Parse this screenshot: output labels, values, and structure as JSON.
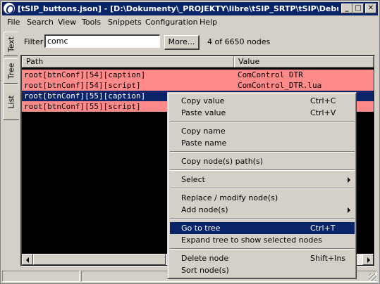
{
  "window": {
    "title": "[tSIP_buttons.json] - [D:\\Dokumenty\\_PROJEKTY\\libre\\tSIP_SRTP\\tSIP\\Debug...",
    "minimize_symbol": "_",
    "maximize_symbol": "□",
    "close_symbol": "✕"
  },
  "menubar": [
    "File",
    "Search",
    "View",
    "Tools",
    "Snippets",
    "Configuration",
    "Help"
  ],
  "side_tabs": [
    {
      "label": "Text",
      "active": false
    },
    {
      "label": "Tree",
      "active": false
    },
    {
      "label": "List",
      "active": true
    }
  ],
  "filter": {
    "label": "Filter",
    "value": "comc",
    "more_label": "More...",
    "count_text": "4 of 6650 nodes"
  },
  "grid": {
    "columns": [
      "Path",
      "Value"
    ],
    "rows": [
      {
        "path": "root[btnConf][54][caption]",
        "value": "ComControl DTR",
        "state": "match"
      },
      {
        "path": "root[btnConf][54][script]",
        "value": "ComControl_DTR.lua",
        "state": "match"
      },
      {
        "path": "root[btnConf][55][caption]",
        "value": "",
        "state": "selected"
      },
      {
        "path": "root[btnConf][55][script]",
        "value": "",
        "state": "match"
      }
    ]
  },
  "context_menu": {
    "copy_value": {
      "label": "Copy value",
      "shortcut": "Ctrl+C"
    },
    "paste_value": {
      "label": "Paste value",
      "shortcut": "Ctrl+V"
    },
    "copy_name": {
      "label": "Copy name"
    },
    "paste_name": {
      "label": "Paste name"
    },
    "copy_paths": {
      "label": "Copy node(s) path(s)"
    },
    "select": {
      "label": "Select"
    },
    "replace_modify": {
      "label": "Replace / modify node(s)"
    },
    "add_nodes": {
      "label": "Add node(s)"
    },
    "go_to_tree": {
      "label": "Go to tree",
      "shortcut": "Ctrl+T"
    },
    "expand_tree": {
      "label": "Expand tree to show selected nodes"
    },
    "delete_node": {
      "label": "Delete node",
      "shortcut": "Shift+Ins"
    },
    "sort_nodes": {
      "label": "Sort node(s)"
    }
  },
  "colors": {
    "highlight_row": "#ff8a8a",
    "selection": "#0a246a",
    "grid_background": "#000000",
    "face": "#d4d0c8"
  }
}
